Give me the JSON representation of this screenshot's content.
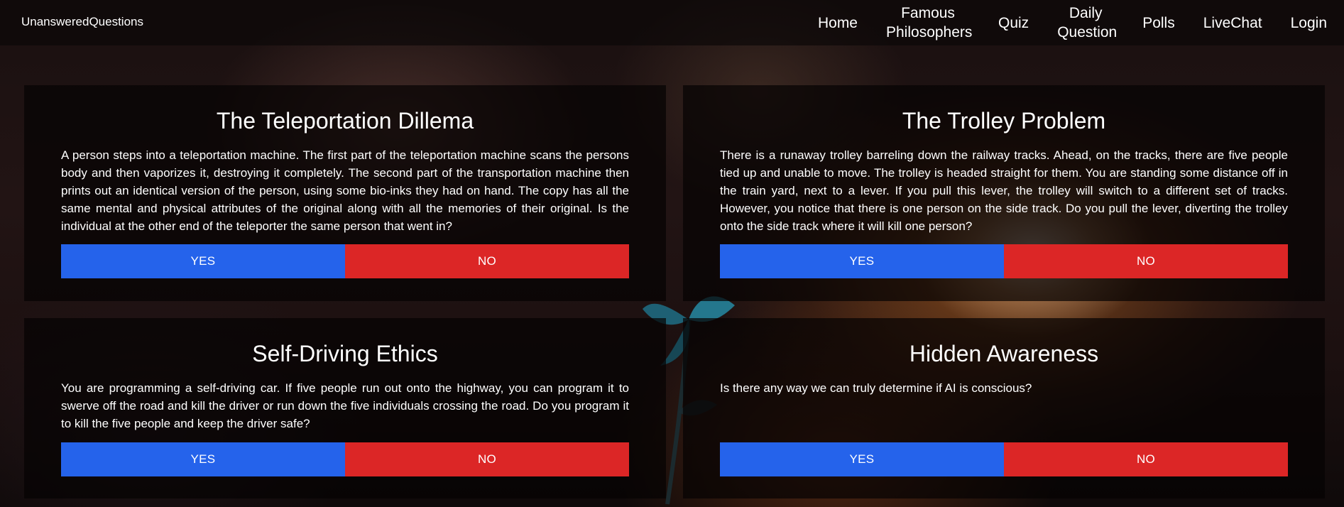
{
  "brand": "UnansweredQuestions",
  "nav": [
    {
      "label": "Home",
      "name": "nav-home"
    },
    {
      "label": "Famous Philosophers",
      "name": "nav-famous-philosophers"
    },
    {
      "label": "Quiz",
      "name": "nav-quiz"
    },
    {
      "label": "Daily Question",
      "name": "nav-daily-question"
    },
    {
      "label": "Polls",
      "name": "nav-polls"
    },
    {
      "label": "LiveChat",
      "name": "nav-livechat"
    },
    {
      "label": "Login",
      "name": "nav-login"
    }
  ],
  "polls": [
    {
      "title": "The Teleportation Dillema",
      "text": "A person steps into a teleportation machine. The first part of the teleportation machine scans the persons body and then vaporizes it, destroying it completely. The second part of the transportation machine then prints out an identical version of the person, using some bio-inks they had on hand. The copy has all the same mental and physical attributes of the original along with all the memories of their original. Is the individual at the other end of the teleporter the same person that went in?",
      "yes": "YES",
      "no": "NO"
    },
    {
      "title": "The Trolley Problem",
      "text": "There is a runaway trolley barreling down the railway tracks. Ahead, on the tracks, there are five people tied up and unable to move. The trolley is headed straight for them. You are standing some distance off in the train yard, next to a lever. If you pull this lever, the trolley will switch to a different set of tracks. However, you notice that there is one person on the side track. Do you pull the lever, diverting the trolley onto the side track where it will kill one person?",
      "yes": "YES",
      "no": "NO"
    },
    {
      "title": "Self-Driving Ethics",
      "text": "You are programming a self-driving car. If five people run out onto the highway, you can program it to swerve off the road and kill the driver or run down the five individuals crossing the road. Do you program it to kill the five people and keep the driver safe?",
      "yes": "YES",
      "no": "NO"
    },
    {
      "title": "Hidden Awareness",
      "text": "Is there any way we can truly determine if AI is conscious?",
      "yes": "YES",
      "no": "NO"
    }
  ],
  "colors": {
    "yes": "#2563eb",
    "no": "#dc2626"
  }
}
